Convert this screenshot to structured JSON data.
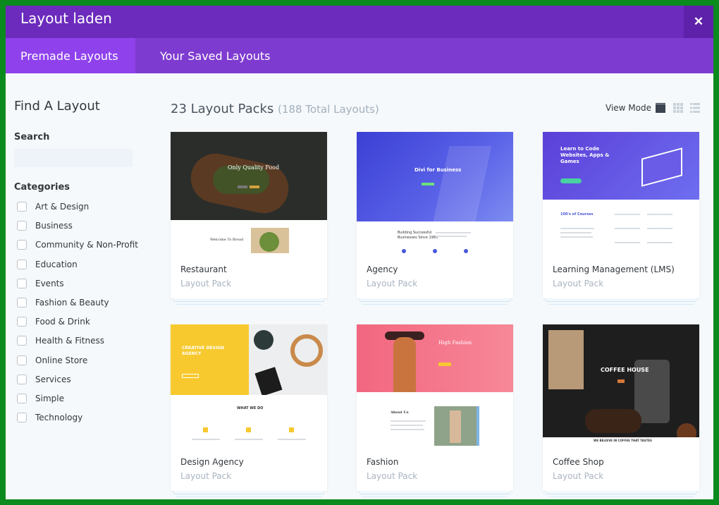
{
  "window": {
    "title": "Layout laden",
    "close_glyph": "✕"
  },
  "tabs": [
    {
      "label": "Premade Layouts",
      "active": true
    },
    {
      "label": "Your Saved Layouts",
      "active": false
    }
  ],
  "sidebar": {
    "heading": "Find A Layout",
    "search_label": "Search",
    "search_value": "",
    "categories_label": "Categories",
    "categories": [
      "Art & Design",
      "Business",
      "Community & Non-Profit",
      "Education",
      "Events",
      "Fashion & Beauty",
      "Food & Drink",
      "Health & Fitness",
      "Online Store",
      "Services",
      "Simple",
      "Technology"
    ]
  },
  "main": {
    "heading": "23 Layout Packs",
    "subheading": "(188 Total Layouts)",
    "view_mode_label": "View Mode",
    "view_mode_icons": [
      "card-view-icon",
      "grid-view-icon",
      "list-view-icon"
    ],
    "cards": [
      {
        "name": "Restaurant",
        "type": "Layout Pack",
        "thumb_title": "Only Quality Food",
        "thumb_sub": "Welcome To Bread"
      },
      {
        "name": "Agency",
        "type": "Layout Pack",
        "thumb_title": "Divi for Business",
        "thumb_sub": "Building Successful Businesses Since 1983"
      },
      {
        "name": "Learning Management (LMS)",
        "type": "Layout Pack",
        "thumb_title": "Learn to Code Websites, Apps & Games",
        "thumb_sub": "100's of Courses"
      },
      {
        "name": "Design Agency",
        "type": "Layout Pack",
        "thumb_title": "CREATIVE DESIGN AGENCY",
        "thumb_sub": "WHAT WE DO"
      },
      {
        "name": "Fashion",
        "type": "Layout Pack",
        "thumb_title": "High Fashion",
        "thumb_sub": "About Us"
      },
      {
        "name": "Coffee Shop",
        "type": "Layout Pack",
        "thumb_title": "COFFEE HOUSE",
        "thumb_sub": "WE BELIEVE IN COFFEE THAT TASTES"
      }
    ]
  },
  "colors": {
    "titlebar": "#6c2bbd",
    "tabbar": "#7e3bd0",
    "active_tab": "#8f42ec",
    "frame": "#0b8a1e"
  }
}
